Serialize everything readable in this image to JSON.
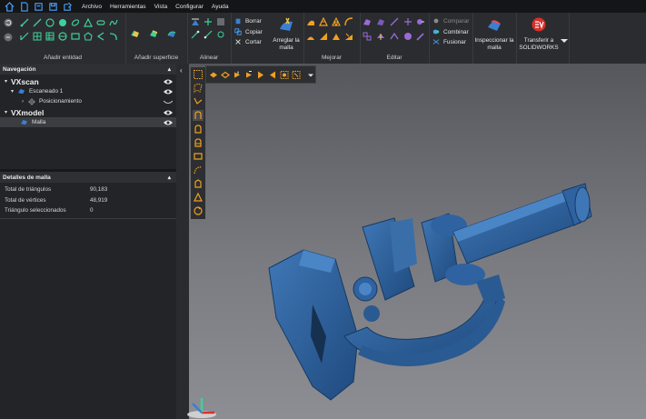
{
  "menu": {
    "items": [
      "Archivo",
      "Herramientas",
      "Vista",
      "Configurar",
      "Ayuda"
    ],
    "quick_icons": [
      "home-icon",
      "new-file-icon",
      "open-icon",
      "save-icon",
      "export-icon"
    ]
  },
  "ribbon": {
    "groups": {
      "add_entity": "Añadir entidad",
      "add_surface": "Añadir superficie",
      "align": "Alinear",
      "improve": "Mejorar",
      "edit": "Editar"
    },
    "clipboard": {
      "delete": "Borrar",
      "copy": "Copiar",
      "cut": "Cortar"
    },
    "fix_mesh": {
      "line1": "Arreglar la",
      "line2": "malla"
    },
    "compare": {
      "compare": "Comparar",
      "combine": "Combinar",
      "merge": "Fusionar"
    },
    "inspect_mesh": {
      "line1": "Inspeccionar la",
      "line2": "malla"
    },
    "transfer": {
      "line1": "Transferir a",
      "line2": "SOLIDWORKS"
    }
  },
  "navigation": {
    "title": "Navegación",
    "vxscan": "VXscan",
    "scan1": "Escaneado 1",
    "positioning": "Posicionamiento",
    "vxmodel": "VXmodel",
    "mesh": "Malla"
  },
  "mesh_details": {
    "title": "Detalles de malla",
    "rows": [
      {
        "label": "Total de triángulos",
        "value": "90,183"
      },
      {
        "label": "Total de vértices",
        "value": "48,919"
      },
      {
        "label": "Triángulo seleccionados",
        "value": "0"
      }
    ]
  },
  "colors": {
    "accent": "#3b7fd1",
    "model": "#2d5f9a",
    "selection": "#f0a020",
    "text": "#e6e6e6"
  }
}
